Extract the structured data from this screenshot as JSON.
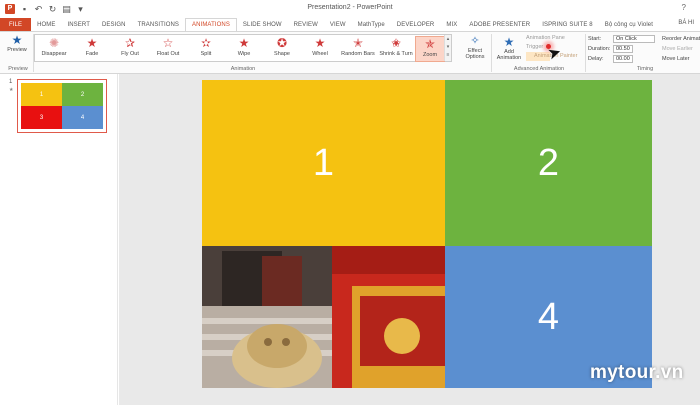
{
  "window": {
    "title": "Presentation2 - PowerPoint",
    "help": "?",
    "user": "BÁ HI"
  },
  "quick_access": {
    "app_icon": "powerpoint-icon",
    "items": [
      "save-icon",
      "undo-icon",
      "redo-icon",
      "start-from-beginning-icon"
    ]
  },
  "tabs": [
    "FILE",
    "HOME",
    "INSERT",
    "DESIGN",
    "TRANSITIONS",
    "ANIMATIONS",
    "SLIDE SHOW",
    "REVIEW",
    "VIEW",
    "MathType",
    "DEVELOPER",
    "MIX",
    "ADOBE PRESENTER",
    "ISPRING SUITE 8",
    "Bộ công cụ Violet"
  ],
  "active_tab": "ANIMATIONS",
  "ribbon": {
    "preview": {
      "label": "Preview",
      "group": "Preview"
    },
    "animation_group": "Animation",
    "effects": [
      "Disappear",
      "Fade",
      "Fly Out",
      "Float Out",
      "Split",
      "Wipe",
      "Shape",
      "Wheel",
      "Random Bars",
      "Shrink & Turn",
      "Zoom"
    ],
    "selected_effect": "Zoom",
    "effect_options": "Effect Options",
    "add_animation": "Add Animation",
    "advanced_group": "Advanced Animation",
    "animation_pane": "Animation Pane",
    "trigger": "Trigger",
    "animation_painter": "Animation Painter",
    "timing_group": "Timing",
    "start_label": "Start:",
    "start_value": "On Click",
    "duration_label": "Duration:",
    "duration_value": "00.50",
    "delay_label": "Delay:",
    "delay_value": "00.00",
    "reorder_title": "Reorder Animation",
    "move_earlier": "Move Earlier",
    "move_later": "Move Later"
  },
  "thumbnails": {
    "slide_number": "1",
    "animation_marker": "★",
    "cells": [
      "1",
      "2",
      "3",
      "4"
    ]
  },
  "slide": {
    "quadrants": [
      "1",
      "2",
      "4"
    ]
  },
  "watermark": "mytour.vn",
  "colors": {
    "accent": "#d24726",
    "yellow": "#f5c211",
    "green": "#6db33f",
    "blue": "#5b8fd0",
    "red": "#e81010"
  }
}
